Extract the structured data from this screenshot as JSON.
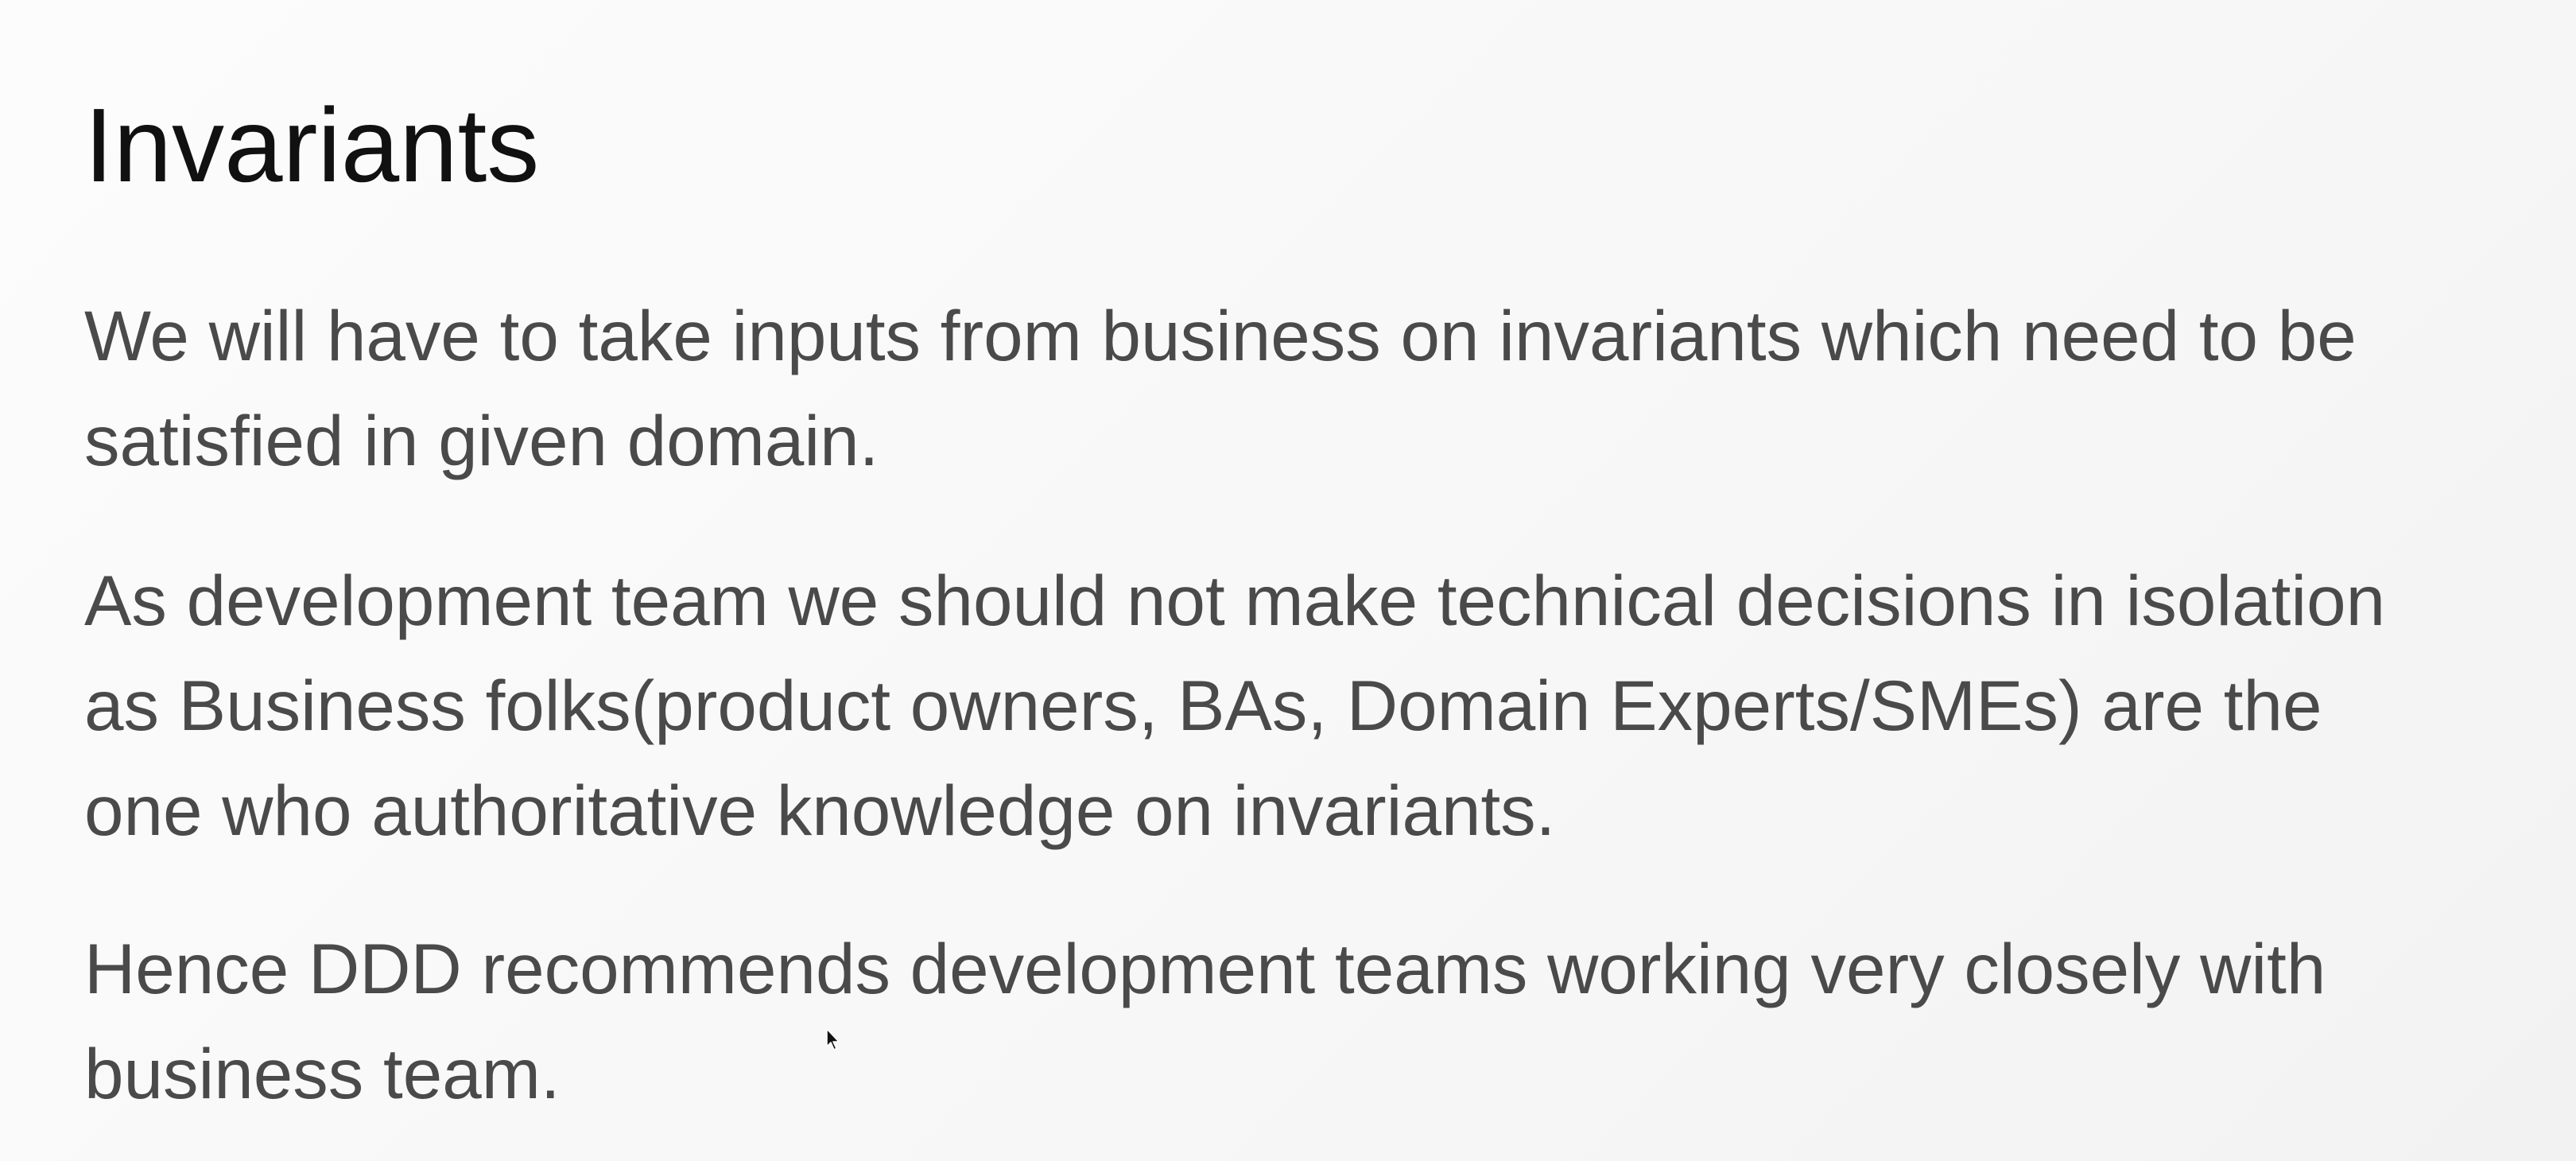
{
  "slide": {
    "title": "Invariants",
    "paragraphs": [
      {
        "lines": [
          "We will have to take inputs from business on invariants which need to be",
          "satisfied in given domain."
        ]
      },
      {
        "lines": [
          "As development team we should not make technical decisions in isolation",
          "as Business folks(product owners, BAs, Domain Experts/SMEs) are the",
          "one who authoritative knowledge on invariants."
        ]
      },
      {
        "lines": [
          "Hence DDD recommends development teams working very closely with",
          "business team."
        ]
      }
    ]
  },
  "colors": {
    "background": "#f9f9f9",
    "title": "#111111",
    "body_text": "#4a4a4a"
  },
  "icons": {
    "cursor": "mouse-pointer-icon"
  }
}
